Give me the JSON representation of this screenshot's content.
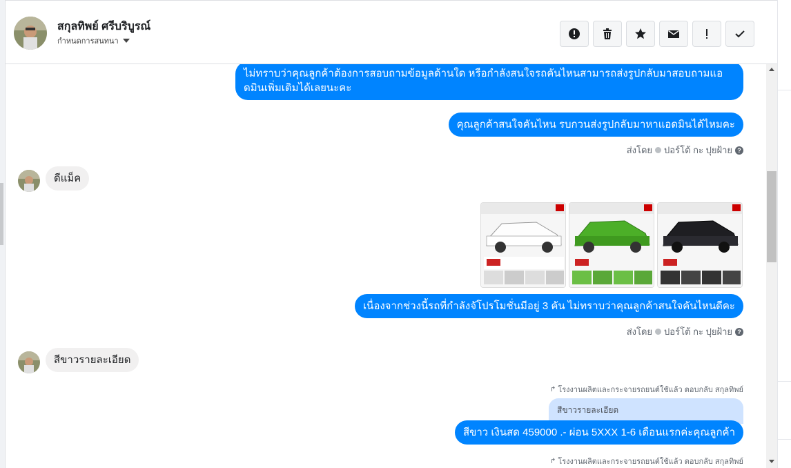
{
  "header": {
    "contact_name": "สกุลทิพย์ ศรีบริบูรณ์",
    "label_dropdown": "กำหนดการสนทนา",
    "toolbar": [
      {
        "icon": "alert-circle-icon"
      },
      {
        "icon": "trash-icon"
      },
      {
        "icon": "star-icon"
      },
      {
        "icon": "mail-icon"
      },
      {
        "icon": "exclamation-icon"
      },
      {
        "icon": "check-icon"
      }
    ]
  },
  "messages": {
    "m1": "ไม่ทราบว่าคุณลูกค้าต้องการสอบถามข้อมูลด้านใด หรือกำลังสนใจรถคันไหนสามารถส่งรูปกลับมาสอบถามแอดมินเพิ่มเติมได้เลยนะคะ",
    "m2": "คุณลูกค้าสนใจคันไหน รบกวนส่งรูปกลับมาหาแอดมินได้ไหมคะ",
    "sent_by_1": "ส่งโดย",
    "sent_by_1_name": "ปอร์โต้ กะ ปุยฝ้าย",
    "in1": "ดีแม็ค",
    "m3": "เนื่องจากช่วงนี้รถที่กำลังจัโปรโมชั่นมีอยู่ 3 คัน ไม่ทราบว่าคุณลูกค้าสนใจคันไหนดีคะ",
    "sent_by_2": "ส่งโดย",
    "sent_by_2_name": "ปอร์โต้ กะ ปุยฝ้าย",
    "in2": "สีขาวรายละเอียด",
    "reply_meta_1": "โรงงานผลิตและกระจายรถยนต์ใช้แล้ว ตอบกลับ สกุลทิพย์",
    "quote_1": "สีขาวรายละเอียด",
    "m4": "สีขาว เงินสด 459000 .- ผ่อน 5XXX 1-6 เดือนแรกค่ะคุณลูกค้า",
    "reply_meta_2": "โรงงานผลิตและกระจายรถยนต์ใช้แล้ว ตอบกลับ สกุลทิพย์"
  },
  "photos": [
    {
      "color": "#f2f2f2",
      "name": "white-truck-photo"
    },
    {
      "color": "#4caf28",
      "name": "green-truck-photo"
    },
    {
      "color": "#1e1e22",
      "name": "black-truck-photo"
    }
  ],
  "colors": {
    "outgoing_bubble": "#0084ff",
    "incoming_bubble": "#f1f0f0",
    "quote_bubble": "#cfe3ff"
  }
}
